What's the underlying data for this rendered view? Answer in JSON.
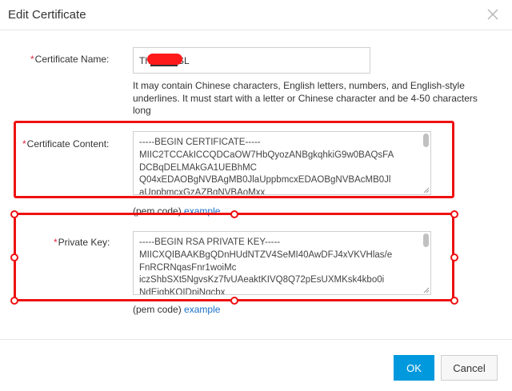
{
  "dialog": {
    "title": "Edit Certificate",
    "close_icon": "close-icon"
  },
  "form": {
    "required_mark": "*",
    "name_label": "Certificate Name:",
    "name_value": "Th████SL",
    "name_help": "It may contain Chinese characters, English letters, numbers, and English-style underlines. It must start with a letter or Chinese character and be 4-50 characters long",
    "content_label": "Certificate Content:",
    "content_lines": "-----BEGIN CERTIFICATE-----\nMIIC2TCCAkICCQDCaOW7HbQyozANBgkqhkiG9w0BAQsFA\nDCBqDELMAkGA1UEBhMC\nQ04xEDAOBgNVBAgMB0JlaUppbmcxEDAOBgNVBAcMB0Jl\naUppbmcxGzAZBgNVBAoMxx",
    "content_pem": "(pem code)",
    "content_example": "example",
    "key_label": "Private Key:",
    "key_lines": "-----BEGIN RSA PRIVATE KEY-----\nMIICXQIBAAKBgQDnHUdNTZV4SeMI40AwDFJ4xVKVHlas/e\nFnRCRNqasFnr1woiMc\niczShbSXt5NgvsKz7fvUAeaktKIVQ8Q72pEsUXMKsk4kbo0i\nNdEiqbKOIDpiNqcbx",
    "key_pem": "(pem code)",
    "key_example": "example"
  },
  "footer": {
    "ok_label": "OK",
    "cancel_label": "Cancel"
  },
  "colors": {
    "primary": "#0099dd",
    "required": "#e6233f",
    "annotation": "#ee1111",
    "link": "#1a6fc7"
  }
}
